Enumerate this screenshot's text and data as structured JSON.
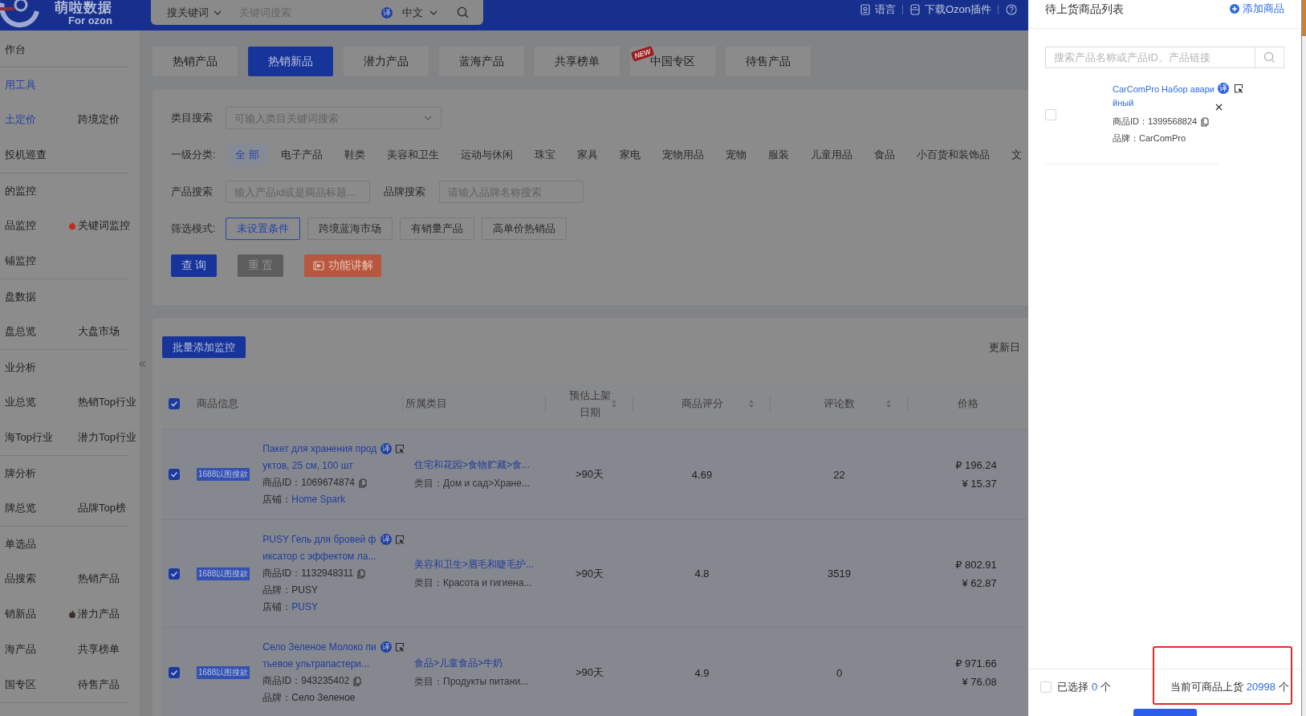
{
  "header": {
    "logo_title": "萌啦数据",
    "logo_subtitle": "For ozon",
    "search": {
      "mode": "搜关键词",
      "placeholder": "关键词搜索",
      "translate_badge": "译",
      "language": "中文"
    },
    "links": [
      {
        "label": "语言"
      },
      {
        "label": "下载Ozon插件"
      }
    ]
  },
  "sidebar": {
    "groups": [
      {
        "heading": "作台",
        "active": false
      },
      {
        "heading": "用工具",
        "active": true,
        "items": [
          {
            "label": "土定价",
            "selected": true,
            "hot": false
          },
          {
            "label": "跨境定价",
            "selected": false,
            "hot": false
          },
          {
            "label": "投机巡查",
            "selected": false,
            "hot": false
          }
        ]
      },
      {
        "heading": "的监控",
        "active": false,
        "items": [
          {
            "label": "品监控",
            "selected": false,
            "hot": false
          },
          {
            "label": "关键词监控",
            "selected": false,
            "hot": true,
            "color": "#c4281c"
          },
          {
            "label": "铺监控",
            "selected": false,
            "hot": false
          }
        ]
      },
      {
        "heading": "盘数据",
        "active": false,
        "items": [
          {
            "label": "盘总览",
            "selected": false,
            "hot": false
          },
          {
            "label": "大盘市场",
            "selected": false,
            "hot": false
          }
        ]
      },
      {
        "heading": "业分析",
        "active": false,
        "items": [
          {
            "label": "业总览",
            "selected": false,
            "hot": false
          },
          {
            "label": "热销Top行业",
            "selected": false,
            "hot": false
          },
          {
            "label": "海Top行业",
            "selected": false,
            "hot": false
          },
          {
            "label": "潜力Top行业",
            "selected": false,
            "hot": false
          }
        ]
      },
      {
        "heading": "牌分析",
        "active": false,
        "items": [
          {
            "label": "牌总览",
            "selected": false,
            "hot": false
          },
          {
            "label": "品牌Top榜",
            "selected": false,
            "hot": false
          }
        ]
      },
      {
        "heading": "单选品",
        "active": false,
        "items": [
          {
            "label": "品搜索",
            "selected": false,
            "hot": false
          },
          {
            "label": "热销产品",
            "selected": false,
            "hot": false
          },
          {
            "label": "销新品",
            "selected": false,
            "hot": false
          },
          {
            "label": "潜力产品",
            "selected": false,
            "hot": true,
            "color": "#3e2c28"
          },
          {
            "label": "海产品",
            "selected": false,
            "hot": false
          },
          {
            "label": "共享榜单",
            "selected": false,
            "hot": false
          },
          {
            "label": "国专区",
            "selected": false,
            "hot": false
          },
          {
            "label": "待售产品",
            "selected": false,
            "hot": false
          }
        ]
      }
    ]
  },
  "tabs": [
    {
      "label": "热销产品",
      "selected": false
    },
    {
      "label": "热销新品",
      "selected": true
    },
    {
      "label": "潜力产品",
      "selected": false
    },
    {
      "label": "蓝海产品",
      "selected": false
    },
    {
      "label": "共享榜单",
      "selected": false
    },
    {
      "label": "中国专区",
      "selected": false,
      "badge": "NEW"
    },
    {
      "label": "待售产品",
      "selected": false
    }
  ],
  "filters": {
    "category_search": {
      "label": "类目搜索",
      "placeholder": "可输入类目关键词搜索"
    },
    "category_level": {
      "label": "一级分类:",
      "options": [
        {
          "label": "全 部",
          "selected": true
        },
        {
          "label": "电子产品",
          "selected": false
        },
        {
          "label": "鞋类",
          "selected": false
        },
        {
          "label": "美容和卫生",
          "selected": false
        },
        {
          "label": "运动与休闲",
          "selected": false
        },
        {
          "label": "珠宝",
          "selected": false
        },
        {
          "label": "家具",
          "selected": false
        },
        {
          "label": "家电",
          "selected": false
        },
        {
          "label": "宠物用品",
          "selected": false
        },
        {
          "label": "宠物",
          "selected": false
        },
        {
          "label": "服装",
          "selected": false
        },
        {
          "label": "儿童用品",
          "selected": false
        },
        {
          "label": "食品",
          "selected": false
        },
        {
          "label": "小百货和装饰品",
          "selected": false
        },
        {
          "label": "文",
          "selected": false
        }
      ]
    },
    "product_search": {
      "label": "产品搜索",
      "placeholder": "输入产品id或是商品标题..."
    },
    "brand_search": {
      "label": "品牌搜索",
      "placeholder": "请输入品牌名称搜索"
    },
    "mode": {
      "label": "筛选模式:",
      "options": [
        {
          "label": "未设置条件",
          "selected": true
        },
        {
          "label": "跨境蓝海市场",
          "selected": false
        },
        {
          "label": "有销量产品",
          "selected": false
        },
        {
          "label": "高单价热销品",
          "selected": false
        }
      ]
    },
    "actions": [
      {
        "label": "查 询",
        "kind": "primary"
      },
      {
        "label": "重 置",
        "kind": "secondary"
      },
      {
        "label": "功能讲解",
        "kind": "video"
      }
    ]
  },
  "table": {
    "toolbar_button": "批量添加监控",
    "update_label": "更新日",
    "all_checked": true,
    "columns": [
      {
        "label": "商品信息",
        "sortable": false
      },
      {
        "label": "所属类目",
        "sortable": false
      },
      {
        "label": "预估上架日期",
        "sortable": true
      },
      {
        "label": "商品评分",
        "sortable": true
      },
      {
        "label": "评论数",
        "sortable": true
      },
      {
        "label": "价格",
        "sortable": false
      }
    ],
    "rows": [
      {
        "checked": true,
        "tag": "1688以图搜款",
        "title": "Пакет для хранения продуктов, 25 см, 100 шт",
        "translate_badge": "译",
        "meta": [
          {
            "kind": "id",
            "label": "商品ID：",
            "value": "1069674874"
          },
          {
            "kind": "link",
            "label": "店铺：",
            "value": "Home Spark"
          }
        ],
        "category_path": "住宅和花园>食物贮藏>食...",
        "category_ru": "类目：Дом и сад>Хране...",
        "listing": ">90天",
        "rating": "4.69",
        "reviews": "22",
        "price_rub": "₽ 196.24",
        "price_cny": "¥ 15.37"
      },
      {
        "checked": true,
        "tag": "1688以图搜款",
        "title": "PUSY Гель для бровей фиксатор с эффектом ла...",
        "translate_badge": "译",
        "meta": [
          {
            "kind": "id",
            "label": "商品ID：",
            "value": "1132948311"
          },
          {
            "kind": "text",
            "label": "品牌：",
            "value": "PUSY"
          },
          {
            "kind": "link",
            "label": "店铺：",
            "value": "PUSY"
          }
        ],
        "category_path": "美容和卫生>眉毛和睫毛护...",
        "category_ru": "类目：Красота и гигиена...",
        "listing": ">90天",
        "rating": "4.8",
        "reviews": "3519",
        "price_rub": "₽ 802.91",
        "price_cny": "¥ 62.87"
      },
      {
        "checked": true,
        "tag": "1688以图搜款",
        "title": "Село Зеленое Молоко питьевое ультрапастери...",
        "translate_badge": "译",
        "meta": [
          {
            "kind": "id",
            "label": "商品ID：",
            "value": "943235402"
          },
          {
            "kind": "text",
            "label": "品牌：",
            "value": "Село Зеленое"
          }
        ],
        "category_path": "食品>儿童食品>牛奶",
        "category_ru": "类目：Продукты питани...",
        "listing": ">90天",
        "rating": "4.9",
        "reviews": "0",
        "price_rub": "₽ 971.66",
        "price_cny": "¥ 76.08"
      }
    ]
  },
  "drawer": {
    "title": "待上货商品列表",
    "add_button": "添加商品",
    "search_placeholder": "搜索产品名称或产品ID、产品链接",
    "items": [
      {
        "checked": false,
        "title": "CarComPro Набор аварийный",
        "translate_badge": "译",
        "id_label": "商品ID：",
        "id": "1399568824",
        "brand_label": "品牌：",
        "brand": "CarComPro"
      }
    ],
    "footer": {
      "select_all_checked": false,
      "selected_label": "已选择",
      "selected_count": "0",
      "selected_unit": "个",
      "available_label": "当前可商品上货",
      "available_count": "20998",
      "available_unit": "个",
      "highlighted": true
    }
  }
}
